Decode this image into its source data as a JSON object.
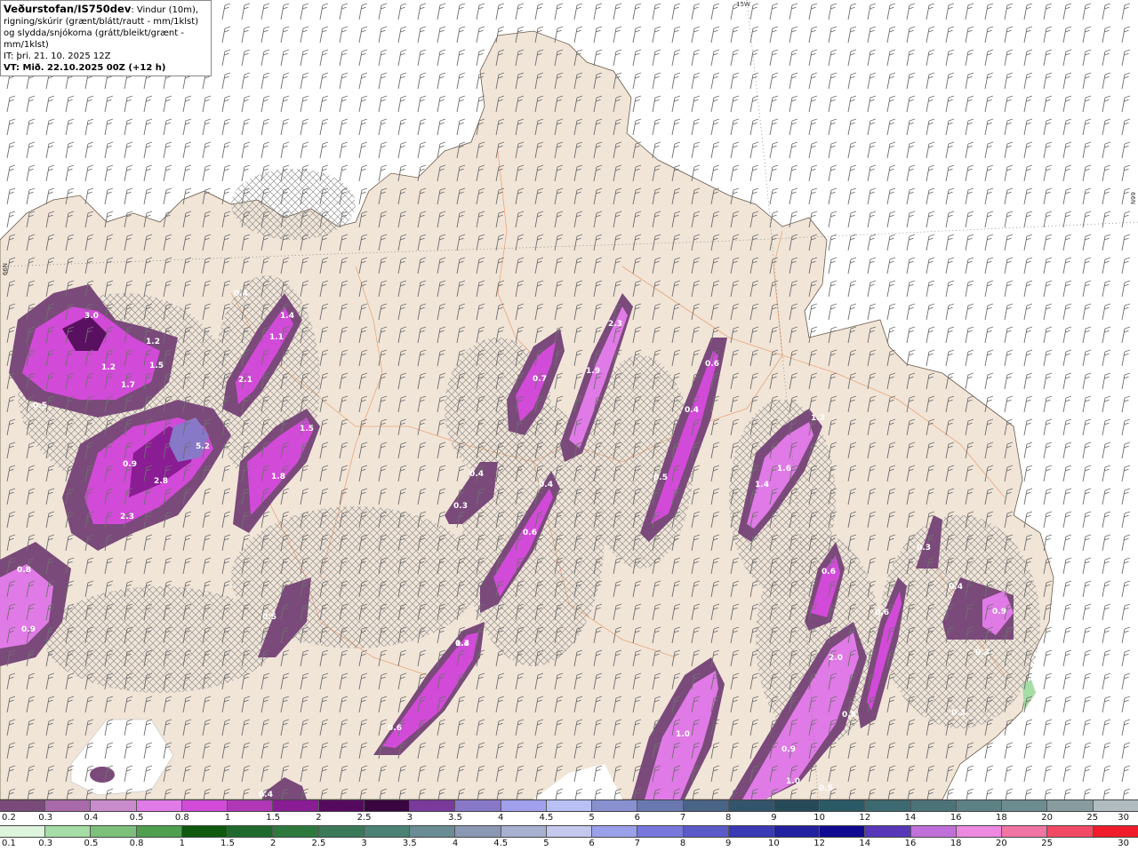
{
  "title": {
    "source": "Veðurstofan/IS750dev",
    "description": ": Vindur (10m), rigning/skúrir (grænt/blátt/rautt - mm/1klst) og slydda/snjókoma (grátt/bleikt/grænt - mm/1klst)",
    "it_line": "IT: þri. 21. 10. 2025 12Z",
    "vt_line": "VT: Mið. 22.10.2025 00Z (+12 h)"
  },
  "grid_labels": {
    "lon_15w": "15W",
    "lat_66n_right": "66N",
    "lat_66n_left": "66N"
  },
  "colors": {
    "land": "#f1e5d8",
    "sea": "#ffffff",
    "roads": "#e8a070",
    "wind_barb": "#6f6f6f",
    "hatch": "#8a8a8a",
    "precip_light": "#7a4a7a",
    "precip_mid": "#c040c8",
    "precip_bright": "#ec6cf0",
    "precip_core": "#5a1060"
  },
  "map_labels": [
    {
      "value": "3.0"
    },
    {
      "value": "1.2"
    },
    {
      "value": "1.5"
    },
    {
      "value": "1.2"
    },
    {
      "value": "1.7"
    },
    {
      "value": "0.5"
    },
    {
      "value": "0.4"
    },
    {
      "value": "1.4"
    },
    {
      "value": "1.1"
    },
    {
      "value": "2.1"
    },
    {
      "value": "5.2"
    },
    {
      "value": "1.5"
    },
    {
      "value": "0.9"
    },
    {
      "value": "2.8"
    },
    {
      "value": "1.8"
    },
    {
      "value": "2.3"
    },
    {
      "value": "0.8"
    },
    {
      "value": "0.9"
    },
    {
      "value": "0.5"
    },
    {
      "value": "0.3"
    },
    {
      "value": "2.3"
    },
    {
      "value": "1.9"
    },
    {
      "value": "0.7"
    },
    {
      "value": "0.6"
    },
    {
      "value": "0.4"
    },
    {
      "value": "0.5"
    },
    {
      "value": "0.4"
    },
    {
      "value": "0.4"
    },
    {
      "value": "0.3"
    },
    {
      "value": "0.6"
    },
    {
      "value": "1.4"
    },
    {
      "value": "0.6"
    },
    {
      "value": "1.6"
    },
    {
      "value": "1.4"
    },
    {
      "value": "1.3"
    },
    {
      "value": "0.6"
    },
    {
      "value": "0.6"
    },
    {
      "value": "2.0"
    },
    {
      "value": "1.0"
    },
    {
      "value": "0.8"
    },
    {
      "value": "0.9"
    },
    {
      "value": "1.0"
    },
    {
      "value": "0.5"
    },
    {
      "value": "0.3"
    },
    {
      "value": "0.4"
    },
    {
      "value": "0.9"
    },
    {
      "value": "0.3"
    },
    {
      "value": "0.3"
    },
    {
      "value": "0.4"
    }
  ],
  "legend_snow": {
    "ticks": [
      "0.2",
      "0.3",
      "0.4",
      "0.5",
      "0.8",
      "1",
      "1.5",
      "2",
      "2.5",
      "3",
      "3.5",
      "4",
      "4.5",
      "5",
      "6",
      "7",
      "8",
      "9",
      "10",
      "12",
      "14",
      "16",
      "18",
      "20",
      "25",
      "30"
    ],
    "colors": [
      "#7a4a78",
      "#a86aa8",
      "#c88ccc",
      "#e07ae6",
      "#d24ad8",
      "#b038b6",
      "#8a1c94",
      "#560a5e",
      "#3a0640",
      "#7a3a9a",
      "#8878c8",
      "#a0a0ec",
      "#b8c0f4",
      "#8890d0",
      "#6a78b0",
      "#4a6488",
      "#34546c",
      "#264a58",
      "#2a5a66",
      "#3c6a70",
      "#4c7478",
      "#5c8084",
      "#6c8c90",
      "#889ca0",
      "#b0bcc0"
    ]
  },
  "legend_rain": {
    "ticks": [
      "0.1",
      "0.3",
      "0.5",
      "0.8",
      "1",
      "1.5",
      "2",
      "2.5",
      "3",
      "3.5",
      "4",
      "4.5",
      "5",
      "6",
      "7",
      "8",
      "9",
      "10",
      "12",
      "14",
      "16",
      "18",
      "20",
      "25",
      "30"
    ],
    "colors": [
      "#ddf5dd",
      "#a6dca6",
      "#7cc07c",
      "#4ea04e",
      "#0e5a0e",
      "#1e6a2e",
      "#2e7a3e",
      "#3a7a5a",
      "#4a8274",
      "#6a8c94",
      "#8a98b4",
      "#a8b0d0",
      "#c4c8ec",
      "#9aa0ea",
      "#7878dc",
      "#5a5ac8",
      "#3a3ab4",
      "#2222a0",
      "#100a90",
      "#5838b8",
      "#c070d8",
      "#ec88e0",
      "#f074a4",
      "#f24a64",
      "#f01c2c"
    ]
  }
}
